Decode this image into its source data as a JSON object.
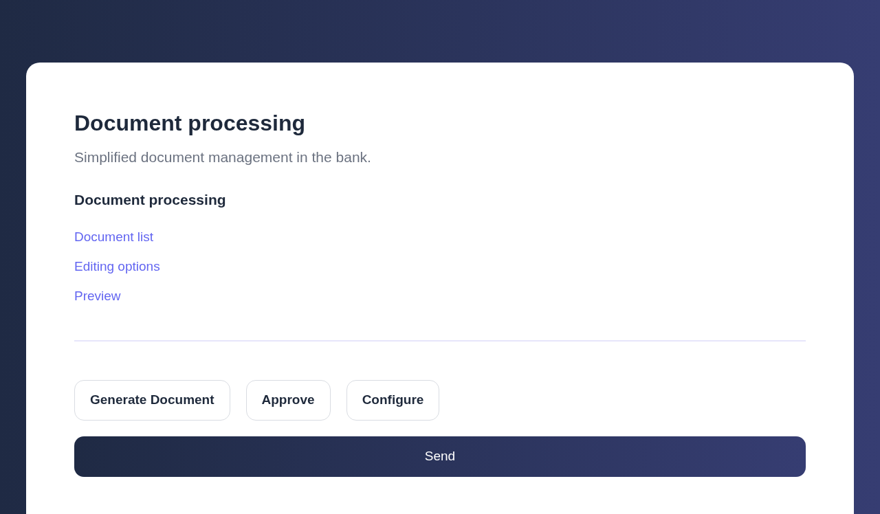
{
  "title": "Document processing",
  "subtitle": "Simplified document management in the bank.",
  "section": {
    "heading": "Document processing",
    "links": [
      "Document list",
      "Editing options",
      "Preview"
    ]
  },
  "actions": [
    "Generate Document",
    "Approve",
    "Configure"
  ],
  "submit": "Send"
}
